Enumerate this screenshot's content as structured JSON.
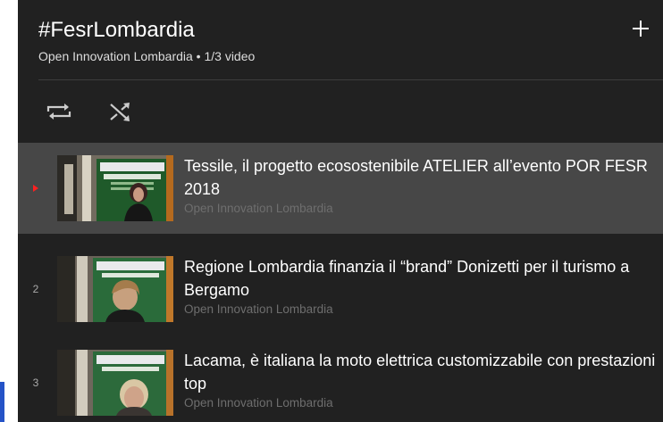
{
  "playlist": {
    "title": "#FesrLombardia",
    "subtitle": "Open Innovation Lombardia • 1/3 video"
  },
  "icons": {
    "add": "plus-icon",
    "loop": "loop-icon",
    "shuffle": "shuffle-icon",
    "now_playing": "play-triangle-icon"
  },
  "colors": {
    "panel_bg": "#212121",
    "active_row_bg": "#474747",
    "now_playing_marker": "#ff2020",
    "channel_text": "#6e6e6e"
  },
  "videos": [
    {
      "index": "",
      "title": "Tessile, il progetto ecosostenibile ATELIER all’evento POR FESR 2018",
      "channel": "Open Innovation Lombardia",
      "playing": true
    },
    {
      "index": "2",
      "title": "Regione Lombardia finanzia il “brand” Donizetti per il turismo a Bergamo",
      "channel": "Open Innovation Lombardia",
      "playing": false
    },
    {
      "index": "3",
      "title": "Lacama, è italiana la moto elettrica customizzabile con prestazioni top",
      "channel": "Open Innovation Lombardia",
      "playing": false
    }
  ]
}
